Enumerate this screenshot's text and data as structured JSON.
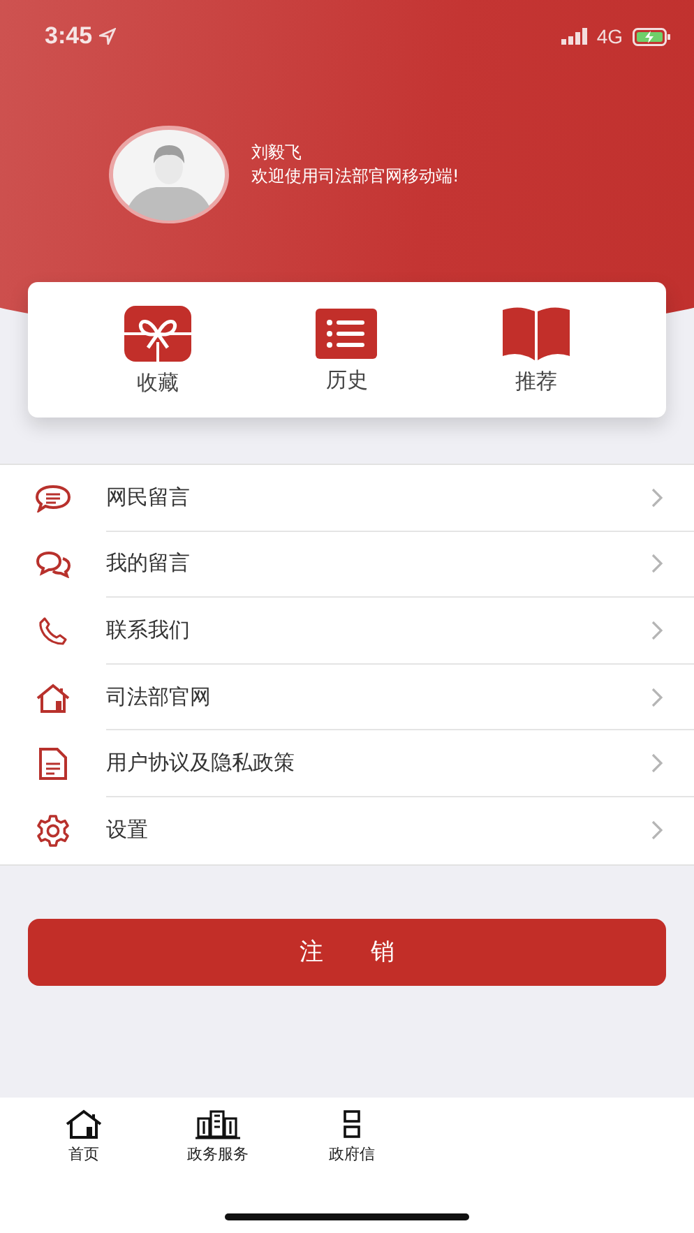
{
  "status_bar": {
    "time": "3:45",
    "network": "4G"
  },
  "profile": {
    "name": "刘毅飞",
    "greeting": "欢迎使用司法部官网移动端!"
  },
  "shortcuts": [
    {
      "label": "收藏"
    },
    {
      "label": "历史"
    },
    {
      "label": "推荐"
    }
  ],
  "menu": [
    {
      "label": "网民留言"
    },
    {
      "label": "我的留言"
    },
    {
      "label": "联系我们"
    },
    {
      "label": "司法部官网"
    },
    {
      "label": "用户协议及隐私政策"
    },
    {
      "label": "设置"
    }
  ],
  "logout_button": "注　　销",
  "tab_bar": [
    {
      "label": "首页"
    },
    {
      "label": "政务服务"
    },
    {
      "label": "政府信"
    }
  ]
}
